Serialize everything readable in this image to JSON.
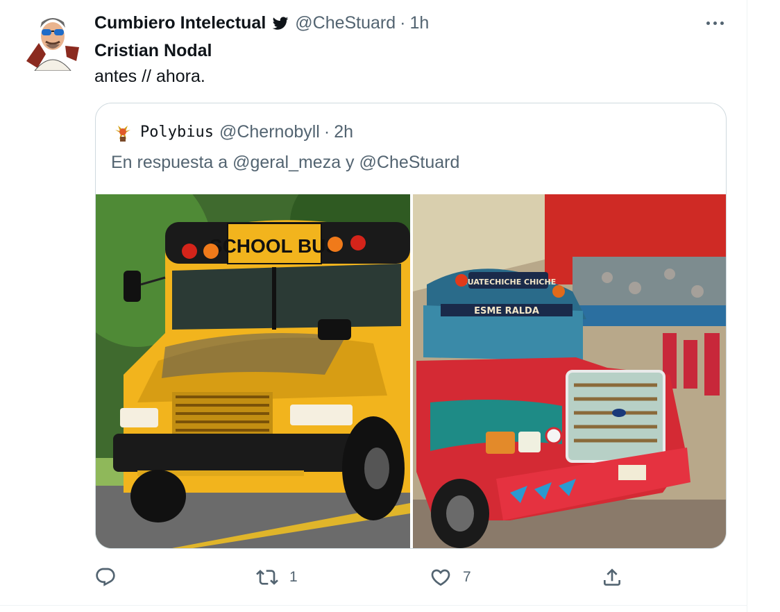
{
  "tweet": {
    "display_name": "Cumbiero Intelectual",
    "handle": "@CheStuard",
    "separator": "·",
    "time": "1h",
    "text_line1": "Cristian Nodal",
    "text_line2": "antes // ahora."
  },
  "quote": {
    "display_name": "Polybius",
    "handle": "@Chernobyll",
    "separator": "·",
    "time": "2h",
    "reply_text": "En respuesta a @geral_meza y @CheStuard",
    "images": [
      {
        "sign_text": "SCHOOL BUS"
      },
      {
        "sign_top": "GUATECHICHE CHICHE",
        "sign_bottom": "ESME RALDA"
      }
    ]
  },
  "actions": {
    "reply_count": "",
    "retweet_count": "1",
    "like_count": "7"
  },
  "colors": {
    "verified": "#0f1419",
    "secondary_text": "#536471",
    "border": "#cfd9de"
  },
  "icons": [
    "verified-icon",
    "more-icon",
    "reply-icon",
    "retweet-icon",
    "like-icon",
    "share-icon"
  ]
}
